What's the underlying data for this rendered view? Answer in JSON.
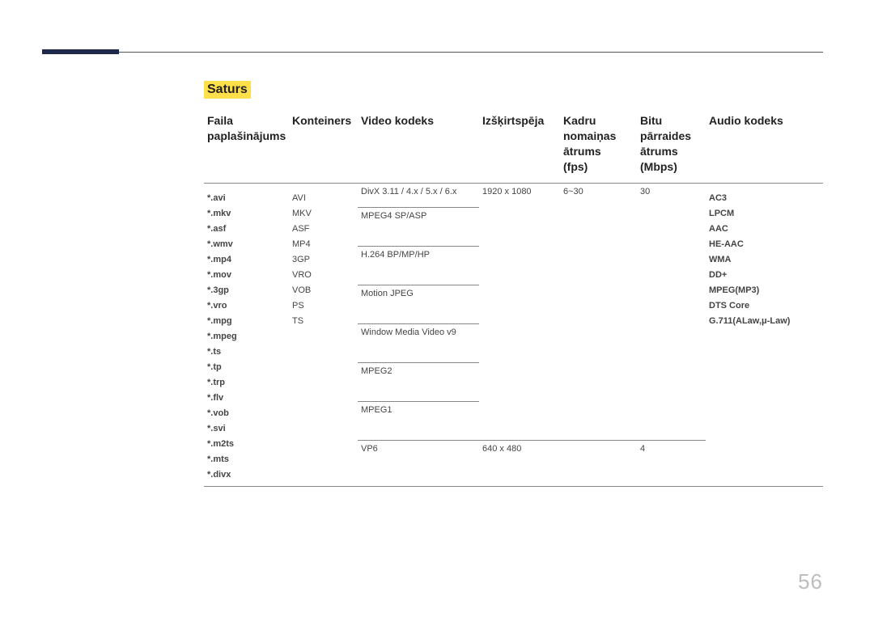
{
  "section_label": "Saturs",
  "page_number": "56",
  "headers": {
    "ext": "Faila\npaplašinājums",
    "container": "Konteiners",
    "vcodec": "Video kodeks",
    "res": "Izšķirtspēja",
    "fps": "Kadru\nnomaiņas\nātrums\n(fps)",
    "bitrate": "Bitu pārraides\nātrums\n(Mbps)",
    "acodec": "Audio kodeks"
  },
  "file_extensions": [
    "*.avi",
    "*.mkv",
    "*.asf",
    "*.wmv",
    "*.mp4",
    "*.mov",
    "*.3gp",
    "*.vro",
    "*.mpg",
    "*.mpeg",
    "*.ts",
    "*.tp",
    "*.trp",
    "*.flv",
    "*.vob",
    "*.svi",
    "*.m2ts",
    "*.mts",
    "*.divx"
  ],
  "containers": [
    "AVI",
    "MKV",
    "ASF",
    "MP4",
    "3GP",
    "VRO",
    "VOB",
    "PS",
    "TS"
  ],
  "audio_codecs": [
    "AC3",
    "LPCM",
    "AAC",
    "HE-AAC",
    "WMA",
    "DD+",
    "MPEG(MP3)",
    "DTS Core",
    "G.711(ALaw,μ-Law)"
  ],
  "chart_data": {
    "type": "table",
    "title": "Supported media formats",
    "columns": [
      "Video kodeks",
      "Izšķirtspēja",
      "Kadru nomaiņas ātrums (fps)",
      "Bitu pārraides ātrums (Mbps)"
    ],
    "rows": [
      {
        "codec": "DivX 3.11 / 4.x / 5.x / 6.x",
        "res": "1920 x 1080",
        "fps": "6~30",
        "bitrate": "30"
      },
      {
        "codec": "MPEG4 SP/ASP",
        "res": "1920 x 1080",
        "fps": "6~30",
        "bitrate": "30"
      },
      {
        "codec": "H.264 BP/MP/HP",
        "res": "1920 x 1080",
        "fps": "6~30",
        "bitrate": "30"
      },
      {
        "codec": "Motion JPEG",
        "res": "1920 x 1080",
        "fps": "6~30",
        "bitrate": "30"
      },
      {
        "codec": "Window Media Video v9",
        "res": "1920 x 1080",
        "fps": "6~30",
        "bitrate": "30"
      },
      {
        "codec": "MPEG2",
        "res": "1920 x 1080",
        "fps": "6~30",
        "bitrate": "30"
      },
      {
        "codec": "MPEG1",
        "res": "1920 x 1080",
        "fps": "6~30",
        "bitrate": "30"
      },
      {
        "codec": "VP6",
        "res": "640 x 480",
        "fps": "",
        "bitrate": "4"
      }
    ]
  }
}
